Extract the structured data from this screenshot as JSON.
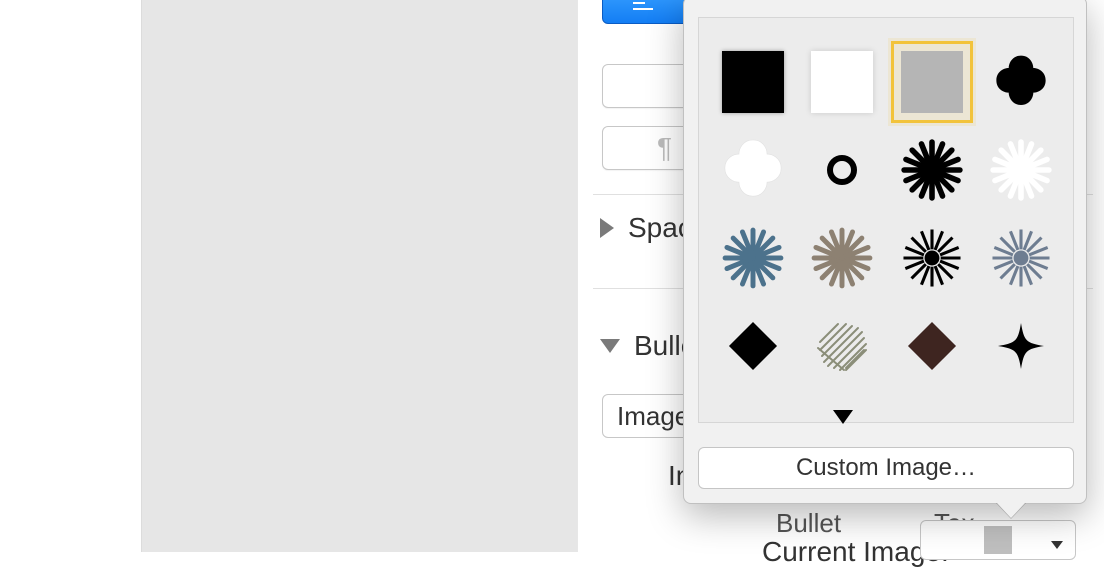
{
  "inspector": {
    "sections": {
      "spacing": "Spac",
      "bullets": "Bulle"
    },
    "dropdown_value": "Image",
    "indent_label": "In",
    "bullet_label": "Bullet",
    "text_label": "Tex",
    "current_image_label": "Current Image:"
  },
  "bullet_popover": {
    "custom_button": "Custom Image…",
    "items": [
      {
        "name": "square-black",
        "kind": "square",
        "color": "#000000"
      },
      {
        "name": "square-white",
        "kind": "square",
        "color": "#ffffff"
      },
      {
        "name": "square-grey",
        "kind": "square",
        "color": "#b5b5b5",
        "selected": true
      },
      {
        "name": "quatrefoil-black",
        "kind": "quatrefoil",
        "color": "#000000"
      },
      {
        "name": "quatrefoil-white",
        "kind": "quatrefoil",
        "color": "#ffffff"
      },
      {
        "name": "circle-outline",
        "kind": "circle-outline",
        "color": "#000000"
      },
      {
        "name": "burst-black",
        "kind": "burst",
        "color": "#000000"
      },
      {
        "name": "burst-white",
        "kind": "burst",
        "color": "#ffffff"
      },
      {
        "name": "burst-steel",
        "kind": "burst",
        "color": "#4c728c"
      },
      {
        "name": "burst-taupe",
        "kind": "burst",
        "color": "#8d8172"
      },
      {
        "name": "sun-black",
        "kind": "sun",
        "color": "#000000"
      },
      {
        "name": "sun-slate",
        "kind": "sun",
        "color": "#6e7d91"
      },
      {
        "name": "diamond-black",
        "kind": "diamond",
        "color": "#000000"
      },
      {
        "name": "diamond-sketch",
        "kind": "scribble-diamond",
        "color": "#8b8e79"
      },
      {
        "name": "diamond-brown",
        "kind": "diamond",
        "color": "#3e2520"
      },
      {
        "name": "fourpoint-star",
        "kind": "fourpoint",
        "color": "#000000"
      }
    ]
  }
}
